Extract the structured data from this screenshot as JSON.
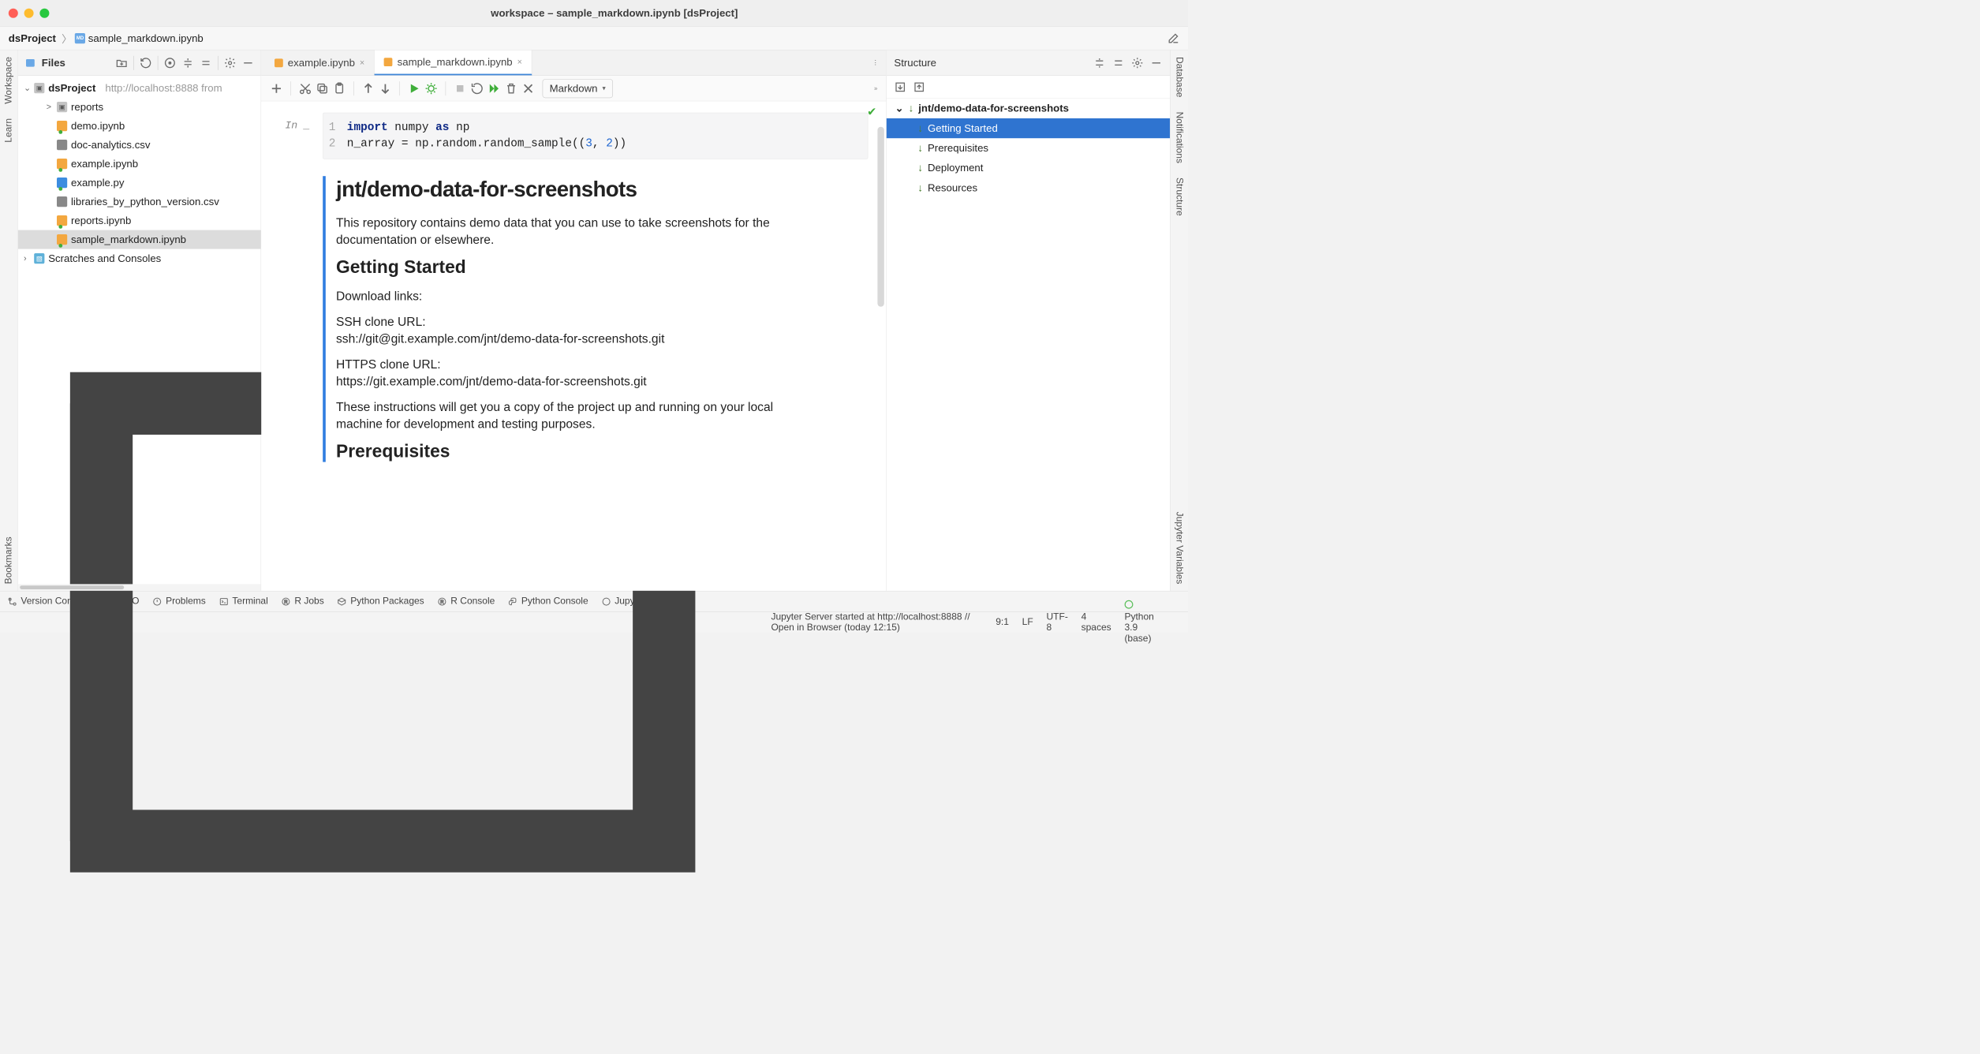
{
  "window_title": "workspace – sample_markdown.ipynb [dsProject]",
  "breadcrumb": {
    "project": "dsProject",
    "file": "sample_markdown.ipynb"
  },
  "rails": {
    "left": [
      "Workspace",
      "Learn",
      "Bookmarks"
    ],
    "right": [
      "Database",
      "Notifications",
      "Structure",
      "Jupyter Variables"
    ]
  },
  "project": {
    "header_label": "Files",
    "root": "dsProject",
    "root_hint": "http://localhost:8888 from",
    "items": [
      {
        "name": "reports",
        "icon": "folder",
        "indent": 1,
        "chev": ">"
      },
      {
        "name": "demo.ipynb",
        "icon": "ipynb",
        "indent": 1,
        "dot": true
      },
      {
        "name": "doc-analytics.csv",
        "icon": "csv",
        "indent": 1
      },
      {
        "name": "example.ipynb",
        "icon": "ipynb",
        "indent": 1,
        "dot": true
      },
      {
        "name": "example.py",
        "icon": "py",
        "indent": 1,
        "dot": true
      },
      {
        "name": "libraries_by_python_version.csv",
        "icon": "csv",
        "indent": 1
      },
      {
        "name": "reports.ipynb",
        "icon": "ipynb",
        "indent": 1,
        "dot": true
      },
      {
        "name": "sample_markdown.ipynb",
        "icon": "ipynb",
        "indent": 1,
        "dot": true,
        "selected": true
      }
    ],
    "scratches": "Scratches and Consoles"
  },
  "tabs": [
    {
      "label": "example.ipynb",
      "active": false
    },
    {
      "label": "sample_markdown.ipynb",
      "active": true
    }
  ],
  "nb_toolbar": {
    "cell_type": "Markdown"
  },
  "code_cell": {
    "prompt": "In _",
    "lines": [
      "import numpy as np",
      "n_array = np.random.random_sample((3, 2))"
    ]
  },
  "markdown": {
    "h1": "jnt/demo-data-for-screenshots",
    "p1": "This repository contains demo data that you can use to take screenshots for the documentation or elsewhere.",
    "h2a": "Getting Started",
    "p2": "Download links:",
    "p3a": "SSH clone URL:",
    "p3b": "ssh://git@git.example.com/jnt/demo-data-for-screenshots.git",
    "p4a": "HTTPS clone URL:",
    "p4b": "https://git.example.com/jnt/demo-data-for-screenshots.git",
    "p5": "These instructions will get you a copy of the project up and running on your local machine for development and testing purposes.",
    "h2b": "Prerequisites"
  },
  "structure": {
    "title": "Structure",
    "root": "jnt/demo-data-for-screenshots",
    "items": [
      {
        "label": "Getting Started",
        "selected": true
      },
      {
        "label": "Prerequisites"
      },
      {
        "label": "Deployment"
      },
      {
        "label": "Resources"
      }
    ]
  },
  "bottom_tabs": [
    "Version Control",
    "TODO",
    "Problems",
    "Terminal",
    "R Jobs",
    "Python Packages",
    "R Console",
    "Python Console",
    "Jupyter"
  ],
  "status": {
    "msg": "Jupyter Server started at http://localhost:8888 // Open in Browser (today 12:15)",
    "pos": "9:1",
    "le": "LF",
    "enc": "UTF-8",
    "indent": "4 spaces",
    "interp": "Python 3.9 (base)"
  }
}
